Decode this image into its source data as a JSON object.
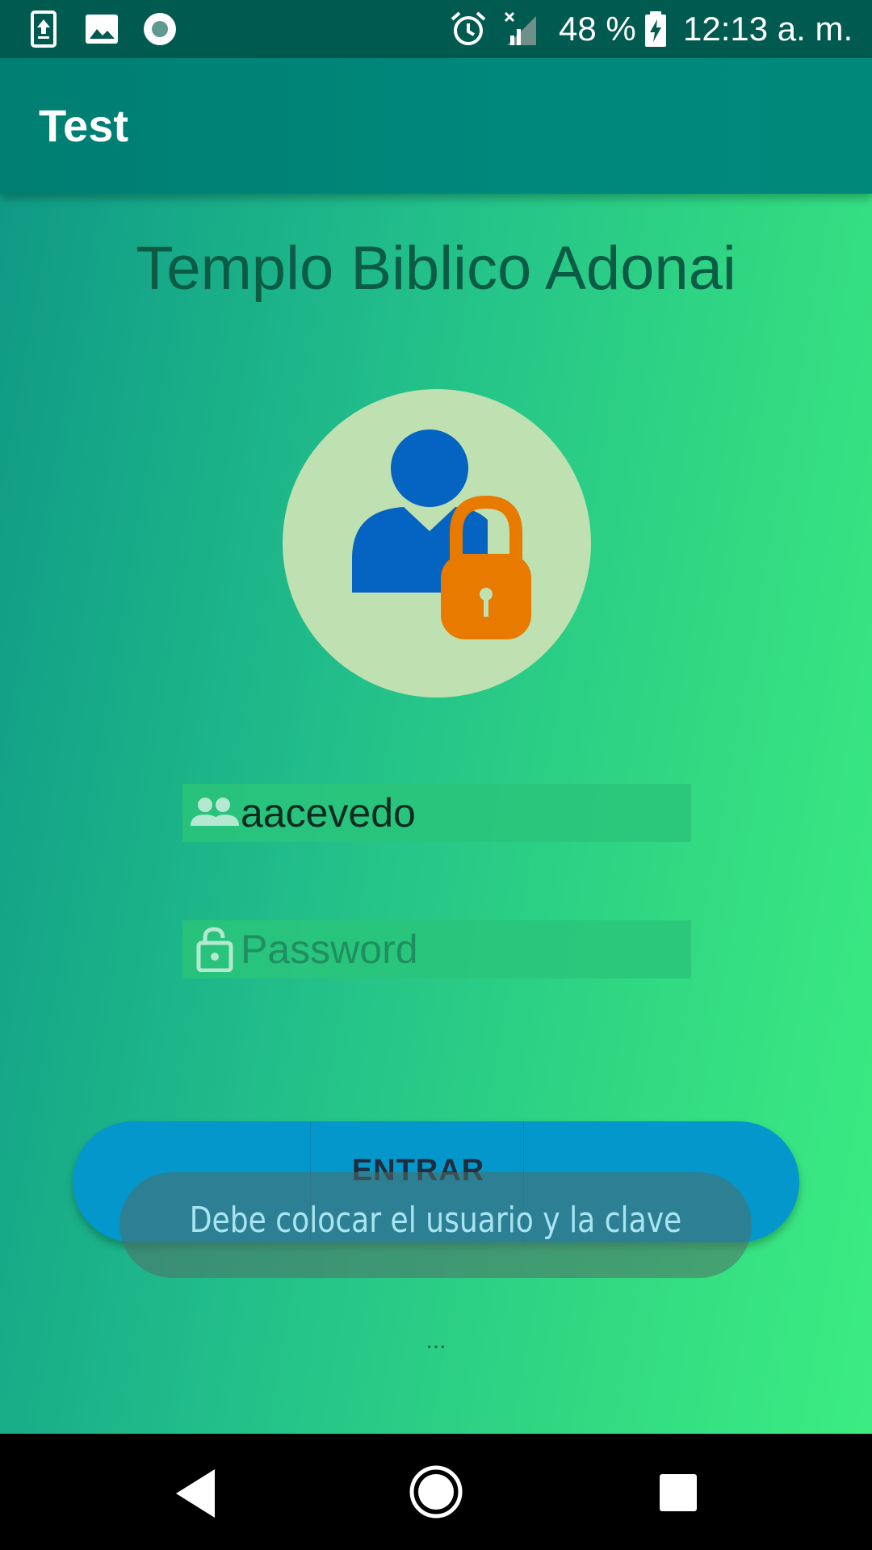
{
  "status_bar": {
    "battery": "48 %",
    "time": "12:13 a. m.",
    "icons": [
      "upload-notification-icon",
      "gallery-notification-icon",
      "record-notification-icon",
      "alarm-icon",
      "no-signal-icon",
      "battery-charging-icon"
    ]
  },
  "app_bar": {
    "title": "Test"
  },
  "main": {
    "org_title": "Templo Biblico Adonai",
    "avatar_icon": "user-lock-icon",
    "username": {
      "value": "aacevedo",
      "icon": "group-icon"
    },
    "password": {
      "value": "",
      "placeholder": "Password",
      "icon": "lock-open-icon"
    },
    "login_button_label": "ENTRAR",
    "toast_message": "Debe colocar el usuario y la clave",
    "footer_text": "..."
  },
  "nav_bar": {
    "icons": [
      "back-icon",
      "home-icon",
      "recents-icon"
    ]
  },
  "colors": {
    "status_bar": "#005a4f",
    "app_bar": "#00897b",
    "gradient_start": "#0f9a86",
    "gradient_end": "#3cec82",
    "button": "#0397cc",
    "avatar_bg": "#bfe0b0",
    "user_blue": "#0563c1",
    "lock_orange": "#e87a00"
  }
}
